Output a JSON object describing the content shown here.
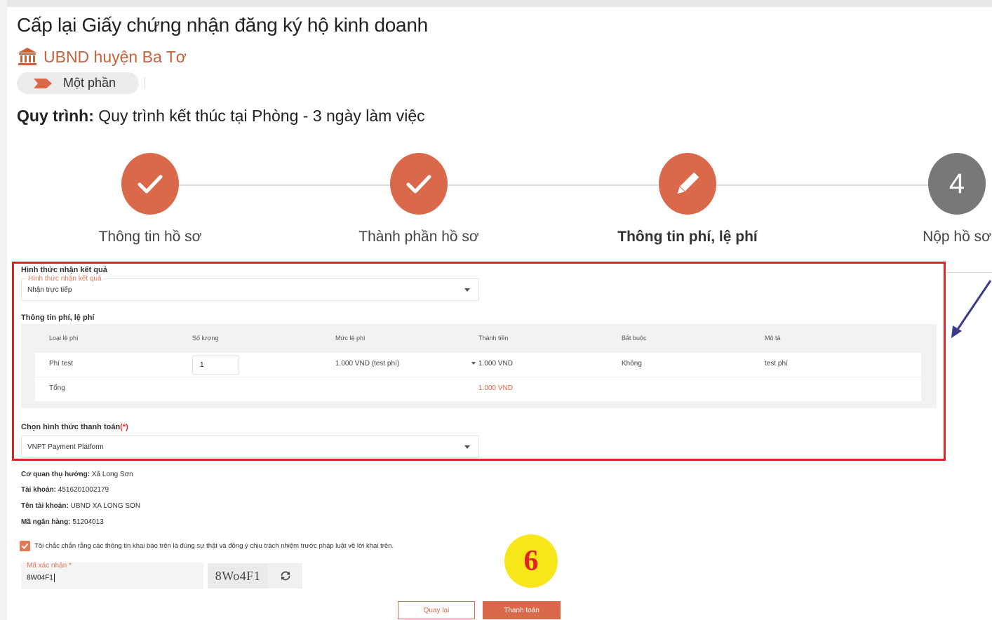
{
  "page": {
    "title": "Cấp lại Giấy chứng nhận đăng ký hộ kinh doanh",
    "agency": "UBND huyện Ba Tơ",
    "level_label": "Một phần",
    "process_label": "Quy trình:",
    "process_value": "Quy trình kết thúc tại Phòng - 3 ngày làm việc"
  },
  "stepper": {
    "steps": [
      {
        "label": "Thông tin hồ sơ",
        "state": "done",
        "icon": "check-icon"
      },
      {
        "label": "Thành phần hồ sơ",
        "state": "done",
        "icon": "check-icon"
      },
      {
        "label": "Thông tin phí, lệ phí",
        "state": "active",
        "icon": "pencil-icon"
      },
      {
        "label": "Nộp hồ sơ",
        "state": "todo",
        "number": "4"
      }
    ]
  },
  "result_method": {
    "section_title": "Hình thức nhận kết quả",
    "field_label": "Hình thức nhận kết quả",
    "value": "Nhận trực tiếp"
  },
  "fees": {
    "section_title": "Thông tin phí, lệ phí",
    "columns": [
      "Loại lệ phí",
      "Số lượng",
      "Mức lệ phí",
      "Thành tiền",
      "Bắt buộc",
      "Mô tả"
    ],
    "row": {
      "type": "Phí test",
      "quantity": "1",
      "rate": "1.000 VND (test phí)",
      "amount": "1.000 VND",
      "required": "Không",
      "description": "test phí"
    },
    "total_label": "Tổng",
    "total_value": "1.000 VND"
  },
  "payment": {
    "label": "Chọn hình thức thanh toán",
    "required_mark": "(*)",
    "value": "VNPT Payment Platform"
  },
  "beneficiary": {
    "agency_label": "Cơ quan thụ hưởng:",
    "agency_value": "Xã Long Sơn",
    "account_label": "Tài khoản:",
    "account_value": "4516201002179",
    "account_name_label": "Tên tài khoản:",
    "account_name_value": "UBND XA LONG SON",
    "bank_code_label": "Mã ngân hàng:",
    "bank_code_value": "51204013"
  },
  "commitment": {
    "checked": true,
    "text": "Tôi chắc chắn rằng các thông tin khai báo trên là đúng sự thật và đồng ý chịu trách nhiệm trước pháp luật về lời khai trên."
  },
  "captcha": {
    "label": "Mã xác nhận *",
    "input_value": "8W04F1",
    "image_text": "8Wo4F1"
  },
  "annotation": {
    "badge_number": "6",
    "color": "#f7e61a"
  },
  "buttons": {
    "back": "Quay lại",
    "pay": "Thanh toán"
  },
  "colors": {
    "accent": "#d9694a",
    "highlight_border": "#e02424",
    "step_todo": "#7a7877"
  }
}
